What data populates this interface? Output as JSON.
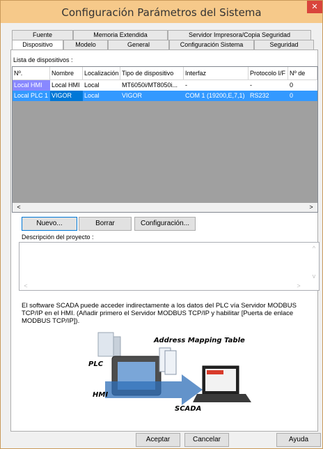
{
  "window": {
    "title": "Configuración Parámetros del Sistema",
    "close_glyph": "✕"
  },
  "tabs_row1": [
    "Fuente",
    "Memoria Extendida",
    "Servidor Impresora/Copia Seguridad"
  ],
  "tabs_row2": [
    "Dispositivo",
    "Modelo",
    "General",
    "Configuración Sistema",
    "Seguridad"
  ],
  "device_list_label": "Lista de dispositivos :",
  "table": {
    "headers": [
      "Nº.",
      "Nombre",
      "Localización",
      "Tipo de dispositivo",
      "Interfaz",
      "Protocolo I/F",
      "Nº de"
    ],
    "rows": [
      [
        "Local HMI",
        "Local HMI",
        "Local",
        "MT6050i/MT8050i...",
        "-",
        "-",
        "0"
      ],
      [
        "Local PLC 1",
        "VIGOR",
        "Local",
        "VIGOR",
        "COM 1 (19200,E,7,1)",
        "RS232",
        "0"
      ]
    ]
  },
  "buttons": {
    "new": "Nuevo...",
    "delete": "Borrar",
    "config": "Configuración...",
    "accept": "Aceptar",
    "cancel": "Cancelar",
    "help": "Ayuda"
  },
  "project_desc_label": "Descripción del proyecto :",
  "info_text": "El software SCADA puede acceder indirectamente a los datos del PLC vía Servidor MODBUS TCP/IP en el HMI. (Añadir primero el Servidor MODBUS TCP/IP y habilitar [Puerta de enlace MODBUS TCP/IP]).",
  "diagram": {
    "title": "Address Mapping Table",
    "plc": "PLC",
    "hmi": "HMI",
    "scada": "SCADA"
  }
}
